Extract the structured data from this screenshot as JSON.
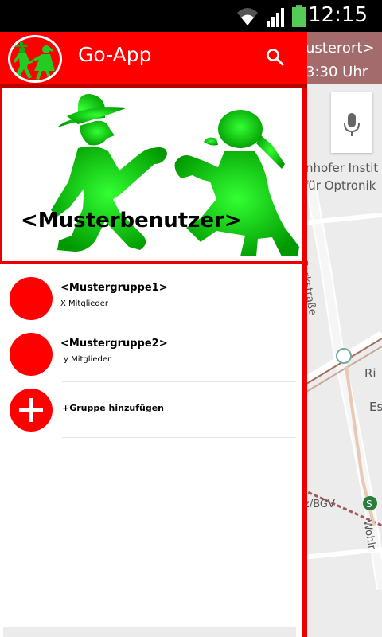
{
  "status_bar": {
    "time": "12:15",
    "icons": [
      "wifi-icon",
      "signal-icon",
      "battery-icon"
    ]
  },
  "app_bar": {
    "title": "Go-App",
    "logo_icon": "ampelmann-logo-icon",
    "search_icon": "search-icon"
  },
  "profile": {
    "name": "<Musterbenutzer>"
  },
  "groups": [
    {
      "name": "<Mustergruppe1>",
      "members": "X Mitglieder"
    },
    {
      "name": "<Mustergruppe2>",
      "members": "y Mitglieder"
    }
  ],
  "add_group": {
    "label": "+Gruppe hinzufügen"
  },
  "map": {
    "header_line1": "usterort>",
    "header_line2": "3:30 Uhr",
    "labels": {
      "institute": "nhofer Instit",
      "optronik": "für Optronik",
      "street": "Parkstraße",
      "ri": "Ri",
      "es": "Es",
      "station": "z/BGV",
      "wohl": "Wohlr"
    }
  },
  "colors": {
    "primary": "#ff0000",
    "map_header": "#a36b6b",
    "ampel_green": "#22dd22"
  }
}
